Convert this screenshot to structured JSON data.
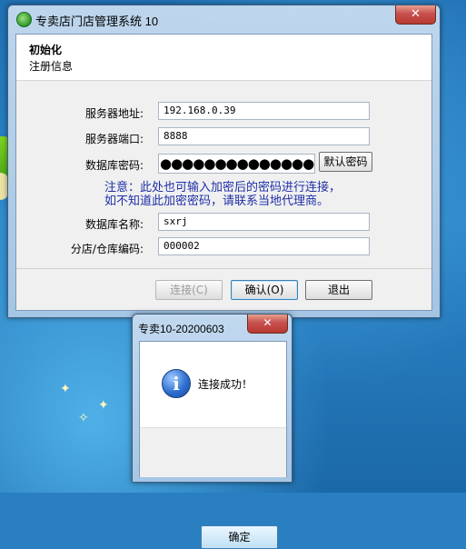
{
  "main_window": {
    "title": "专卖店门店管理系统 10",
    "close_symbol": "✕",
    "header": {
      "title": "初始化",
      "subtitle": "注册信息"
    },
    "fields": {
      "server_address": {
        "label": "服务器地址:",
        "value": "192.168.0.39"
      },
      "server_port": {
        "label": "服务器端口:",
        "value": "8888"
      },
      "db_password": {
        "label": "数据库密码:",
        "value": "●●●●●●●●●●●●●●●●"
      },
      "db_name": {
        "label": "数据库名称:",
        "value": "sxrj"
      },
      "store_code": {
        "label": "分店/仓库编码:",
        "value": "000002"
      }
    },
    "default_password_button": "默认密码",
    "note_line1": "注意：此处也可输入加密后的密码进行连接，",
    "note_line2": "如不知道此加密密码，请联系当地代理商。",
    "buttons": {
      "connect": "连接(C)",
      "confirm": "确认(O)",
      "exit": "退出"
    }
  },
  "message_box": {
    "title": "专卖10-20200603",
    "close_symbol": "✕",
    "icon_glyph": "i",
    "message": "连接成功！",
    "ok_button": "确定"
  },
  "icons": [
    "app-icon",
    "close-icon",
    "info-icon"
  ]
}
